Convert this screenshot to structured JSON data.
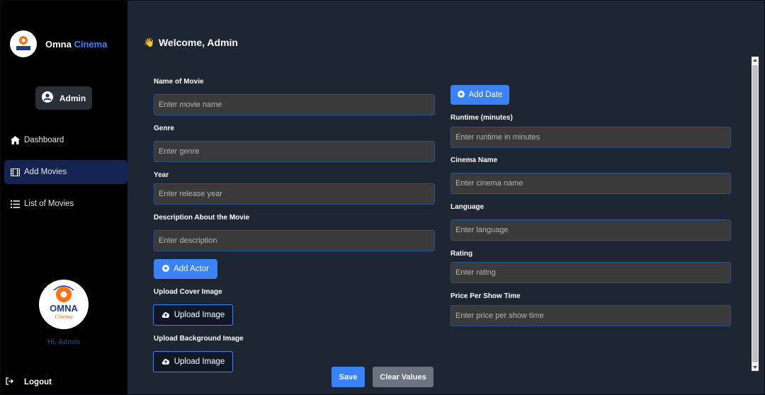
{
  "brand": {
    "name_part1": "Omna",
    "name_part2": "Cinema",
    "logo_text": "OMNA",
    "logo_sub": "Cinema"
  },
  "sidebar": {
    "admin_label": "Admin",
    "items": [
      {
        "label": "Dashboard",
        "icon": "home-icon",
        "active": false
      },
      {
        "label": "Add Movies",
        "icon": "film-icon",
        "active": true
      },
      {
        "label": "List of Movies",
        "icon": "list-icon",
        "active": false
      }
    ],
    "greeting": "Hi, Admin",
    "logout_label": "Logout"
  },
  "header": {
    "welcome": "Welcome, Admin"
  },
  "form": {
    "left": {
      "name_label": "Name of Movie",
      "name_placeholder": "Enter movie name",
      "genre_label": "Genre",
      "genre_placeholder": "Enter genre",
      "year_label": "Year",
      "year_placeholder": "Enter release year",
      "desc_label": "Description About the Movie",
      "desc_placeholder": "Enter description",
      "add_actor_label": "Add Actor",
      "cover_label": "Upload Cover Image",
      "cover_button": "Upload Image",
      "background_label": "Upload Background Image",
      "background_button": "Upload Image"
    },
    "right": {
      "add_date_label": "Add Date",
      "runtime_label": "Runtime (minutes)",
      "runtime_placeholder": "Enter runtime in minutes",
      "cinema_label": "Cinema Name",
      "cinema_placeholder": "Enter cinema name",
      "language_label": "Language",
      "language_placeholder": "Enter language",
      "rating_label": "Rating",
      "rating_placeholder": "Enter rating",
      "price_label": "Price Per Show Time",
      "price_placeholder": "Enter price per show time"
    },
    "save_label": "Save",
    "clear_label": "Clear Values"
  },
  "colors": {
    "accent": "#3b82f6",
    "sidebar_bg": "#000000",
    "main_bg": "#1f2633",
    "input_bg": "#3a3a3a"
  }
}
